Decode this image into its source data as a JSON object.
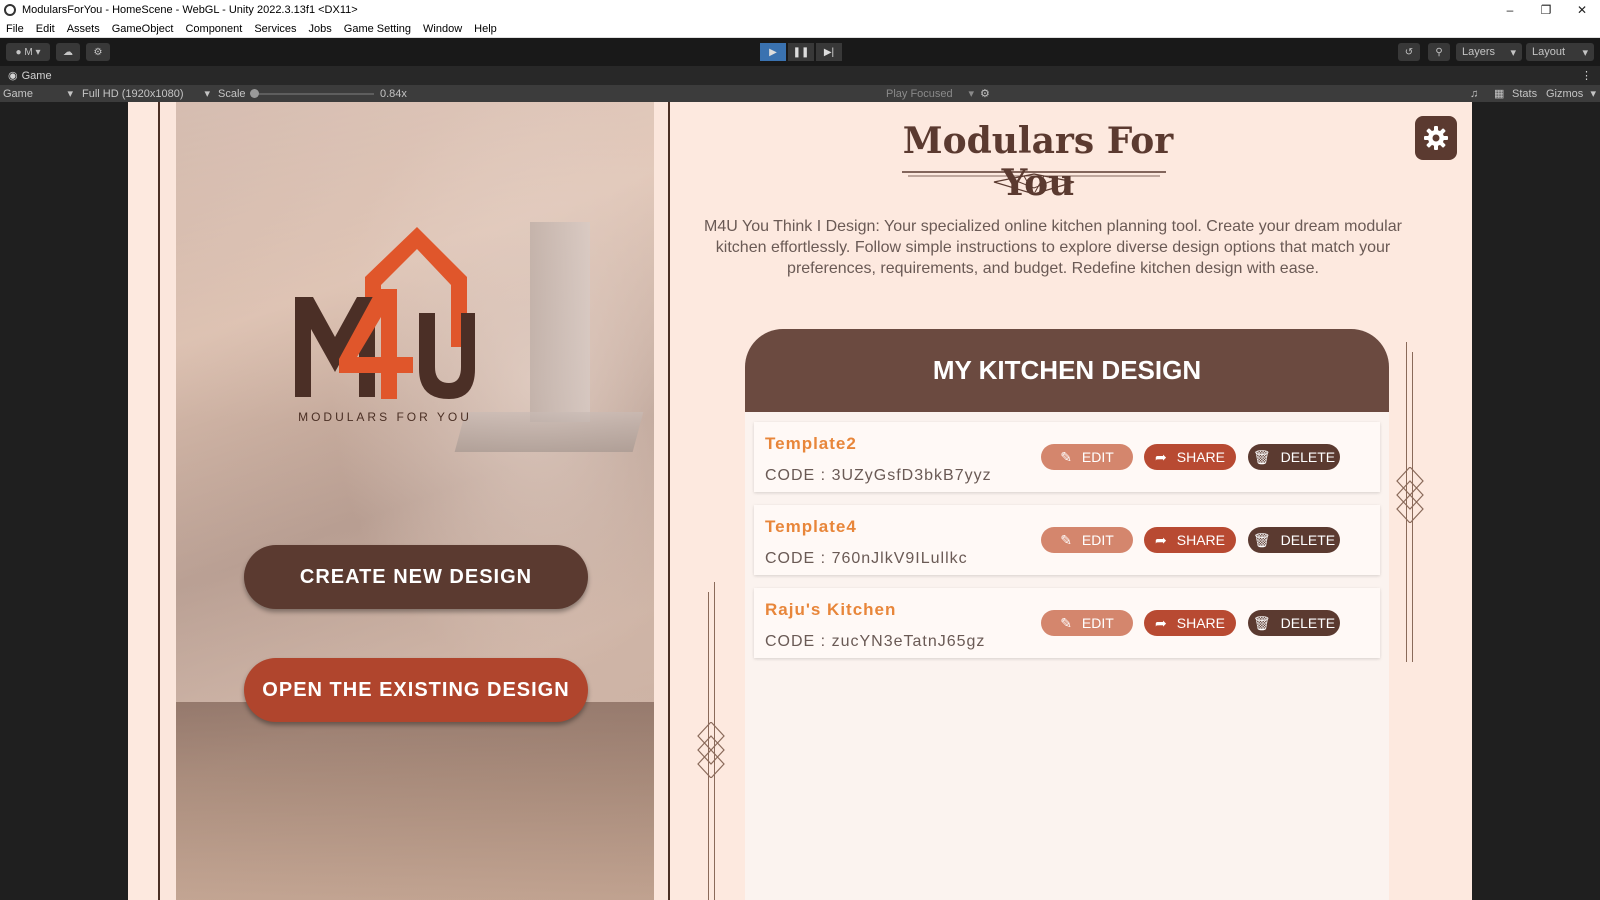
{
  "window": {
    "title": "ModularsForYou - HomeScene - WebGL - Unity 2022.3.13f1 <DX11>"
  },
  "menu": [
    "File",
    "Edit",
    "Assets",
    "GameObject",
    "Component",
    "Services",
    "Jobs",
    "Game Setting",
    "Window",
    "Help"
  ],
  "toolbar": {
    "account": "M",
    "layers": "Layers",
    "layout": "Layout"
  },
  "tabs": {
    "game": "Game"
  },
  "game_controls": {
    "display": "Game",
    "resolution": "Full HD (1920x1080)",
    "scale_label": "Scale",
    "scale_value": "0.84x",
    "play_mode": "Play Focused",
    "stats": "Stats",
    "gizmos": "Gizmos"
  },
  "app": {
    "logo_tagline": "MODULARS FOR YOU",
    "create_button": "CREATE NEW DESIGN",
    "open_button": "OPEN THE EXISTING DESIGN",
    "title": "Modulars For You",
    "description": "M4U You Think I Design: Your specialized online kitchen planning tool. Create your dream modular kitchen effortlessly. Follow simple instructions to explore diverse design options that match your preferences, requirements, and budget. Redefine kitchen design with ease.",
    "panel_title": "MY KITCHEN DESIGN",
    "edit_label": "EDIT",
    "share_label": "SHARE",
    "delete_label": "DELETE",
    "designs": [
      {
        "name": "Template2",
        "code": "CODE : 3UZyGsfD3bkB7yyz"
      },
      {
        "name": "Template4",
        "code": "CODE : 760nJlkV9ILullkc"
      },
      {
        "name": "Raju's Kitchen",
        "code": "CODE : zucYN3eTatnJ65gz"
      }
    ]
  },
  "colors": {
    "brand_brown": "#5b3a30",
    "brand_orange": "#e8863a",
    "share_red": "#b84a32",
    "edit_salmon": "#d4866d"
  }
}
